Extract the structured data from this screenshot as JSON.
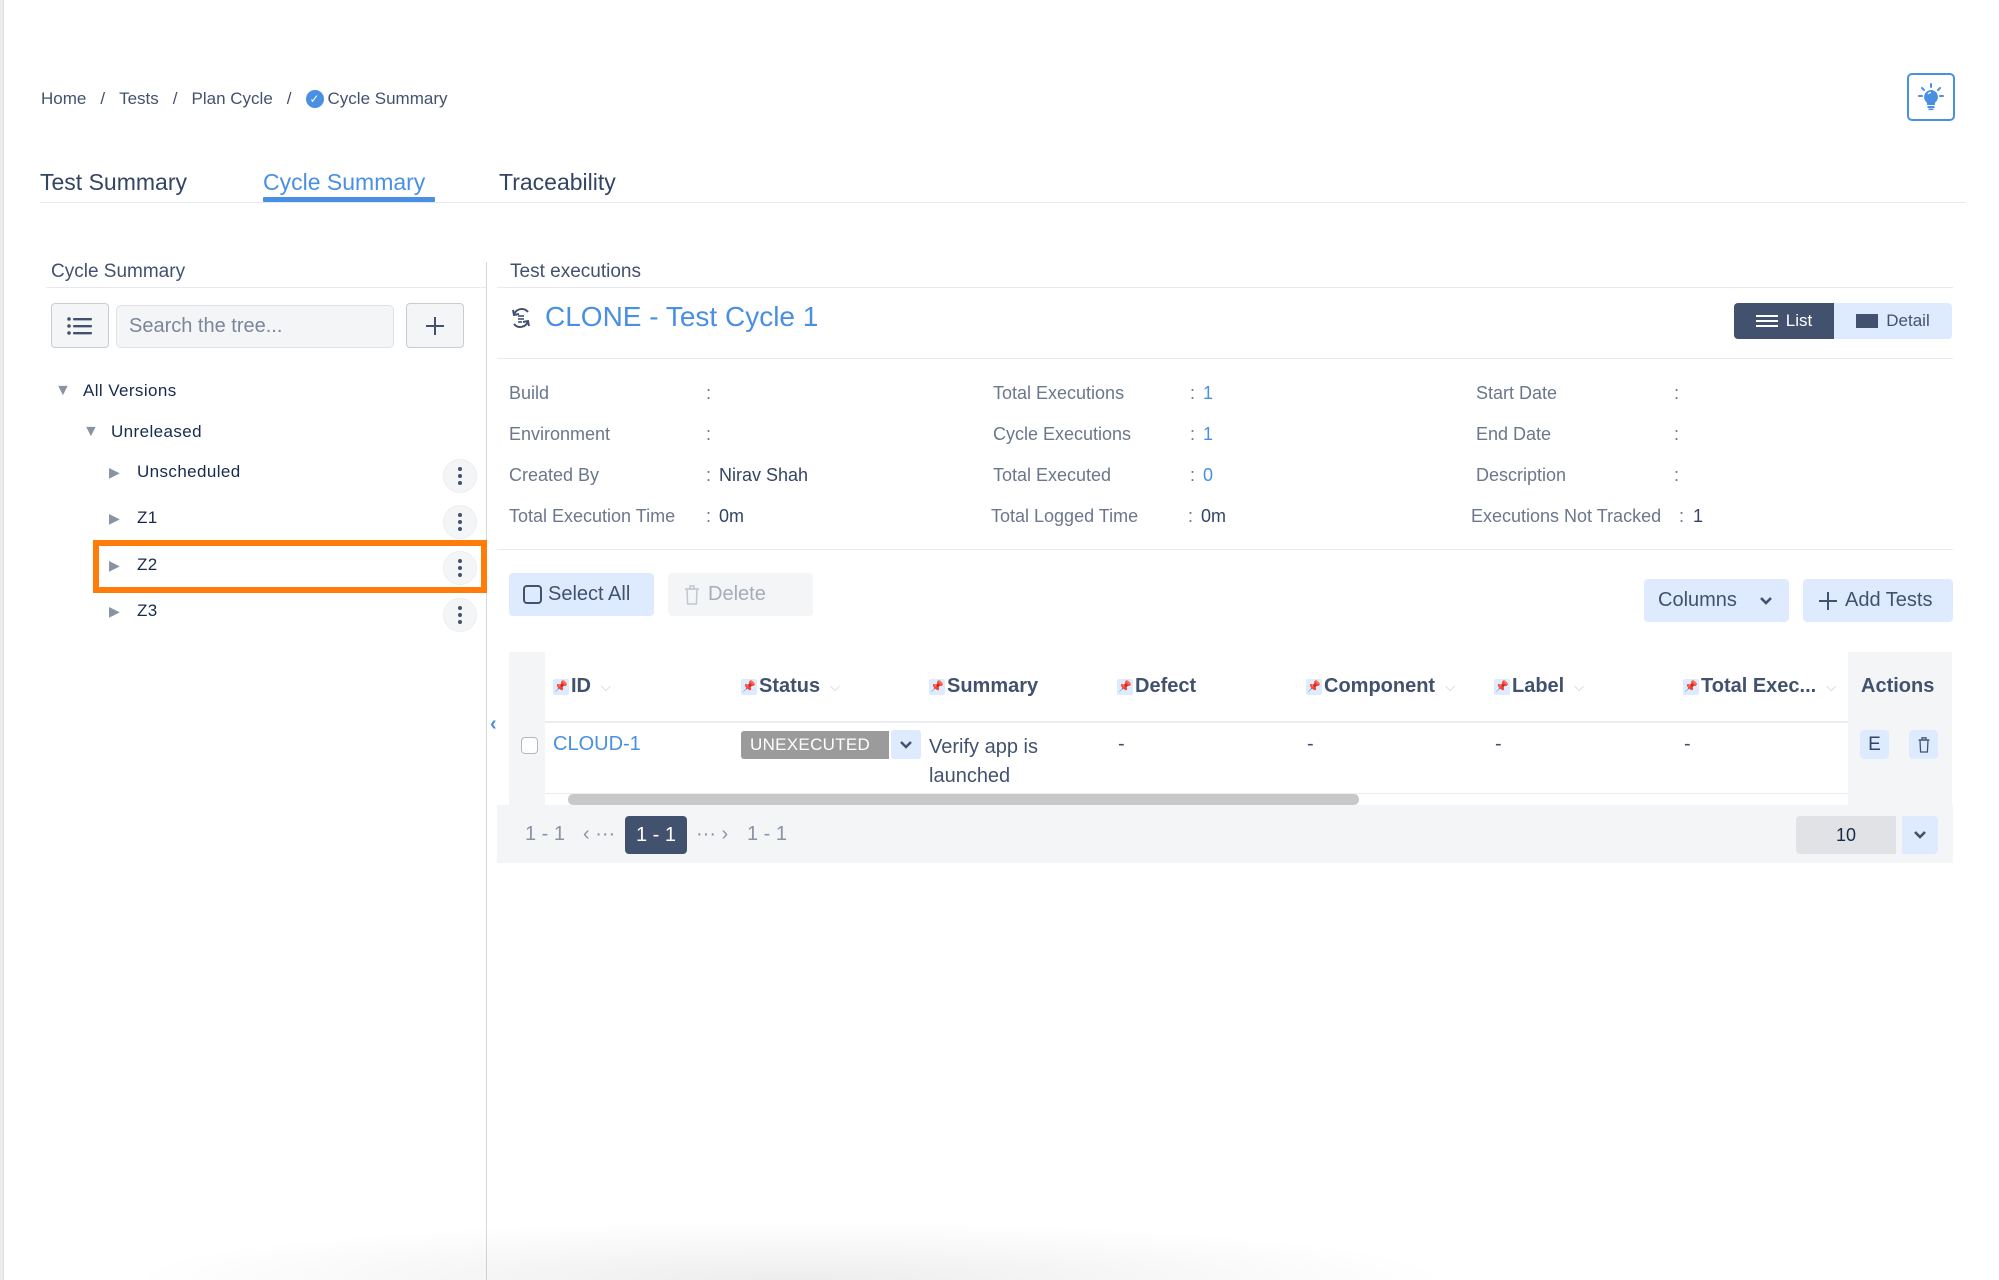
{
  "breadcrumb": {
    "items": [
      "Home",
      "Tests",
      "Plan Cycle",
      "Cycle Summary"
    ],
    "separator": "/"
  },
  "help_button": {
    "icon": "lightbulb-icon"
  },
  "tabs": [
    {
      "label": "Test Summary",
      "active": false
    },
    {
      "label": "Cycle Summary",
      "active": true
    },
    {
      "label": "Traceability",
      "active": false
    }
  ],
  "left_panel": {
    "title": "Cycle Summary",
    "search_placeholder": "Search the tree...",
    "add_label": "+",
    "tree": [
      {
        "label": "All Versions",
        "expanded": true,
        "level": 0
      },
      {
        "label": "Unreleased",
        "expanded": true,
        "level": 1
      },
      {
        "label": "Unscheduled",
        "expanded": false,
        "level": 2
      },
      {
        "label": "Z1",
        "expanded": false,
        "level": 2
      },
      {
        "label": "Z2",
        "expanded": false,
        "level": 2,
        "highlighted": true
      },
      {
        "label": "Z3",
        "expanded": false,
        "level": 2
      }
    ]
  },
  "right_panel": {
    "title": "Test executions",
    "cycle_name": "CLONE - Test Cycle 1",
    "view_toggle": {
      "list": "List",
      "detail": "Detail",
      "active": "List"
    },
    "info": {
      "col1": [
        {
          "label": "Build",
          "value": ""
        },
        {
          "label": "Environment",
          "value": ""
        },
        {
          "label": "Created By",
          "value": "Nirav Shah"
        },
        {
          "label": "Total Execution Time",
          "value": "0m"
        }
      ],
      "col2": [
        {
          "label": "Total Executions",
          "value": "1"
        },
        {
          "label": "Cycle Executions",
          "value": "1"
        },
        {
          "label": "Total Executed",
          "value": "0"
        },
        {
          "label": "Total Logged Time",
          "value": "0m"
        }
      ],
      "col3": [
        {
          "label": "Start Date",
          "value": ""
        },
        {
          "label": "End Date",
          "value": ""
        },
        {
          "label": "Description",
          "value": ""
        },
        {
          "label": "Executions Not Tracked",
          "value": "1"
        }
      ]
    },
    "toolbar": {
      "select_all": "Select All",
      "delete": "Delete",
      "columns": "Columns",
      "add_tests": "Add Tests"
    },
    "table": {
      "columns": [
        "ID",
        "Status",
        "Summary",
        "Defect",
        "Component",
        "Label",
        "Total Exec...",
        "Actions"
      ],
      "rows": [
        {
          "id": "CLOUD-1",
          "status": "UNEXECUTED",
          "summary_line1": "Verify app is",
          "summary_line2": "launched",
          "defect": "-",
          "component": "-",
          "label": "-",
          "total_exec": "-",
          "actions": {
            "edit": "E",
            "delete_icon": "trash-icon"
          }
        }
      ]
    },
    "pagination": {
      "first": "1 - 1",
      "prev_ellipsis": "‹ ···",
      "current": "1 - 1",
      "next_ellipsis": "··· ›",
      "last": "1 - 1",
      "page_size": "10"
    }
  },
  "colors": {
    "accent": "#4a90e2",
    "dark": "#42526e",
    "light_button": "#deebff",
    "highlight": "#ff7c0a",
    "status_unexecuted": "#9b9b9b"
  }
}
